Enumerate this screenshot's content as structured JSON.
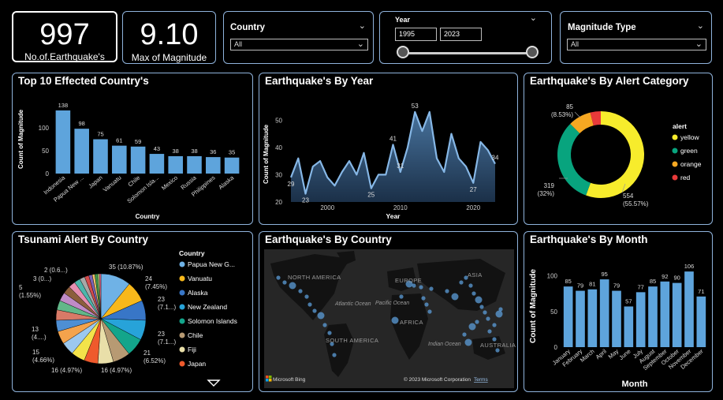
{
  "colors": {
    "bar": "#5ea4dc",
    "border": "#8fb3dc",
    "yellow": "#f7ec2c",
    "green": "#08a47e",
    "orange": "#f6a822",
    "red": "#e83a3a"
  },
  "kpi": {
    "count": {
      "value": "997",
      "label": "No.of.Earthquake's"
    },
    "max": {
      "value": "9.10",
      "label": "Max of Magnitude"
    }
  },
  "filters": {
    "country": {
      "label": "Country",
      "value": "All"
    },
    "year": {
      "label": "Year",
      "from": "1995",
      "to": "2023",
      "range": [
        1995,
        2023
      ]
    },
    "magnitude_type": {
      "label": "Magnitude Type",
      "value": "All"
    }
  },
  "panels": {
    "top10": "Top 10 Effected Country's",
    "by_year": "Earthquake's By Year",
    "alert": "Earthquake's By Alert Category",
    "tsunami": "Tsunami Alert By Country",
    "map": "Earthquake's By Country",
    "month": "Earthquake's By Month"
  },
  "map": {
    "regions": [
      {
        "name": "NORTH AMERICA",
        "style": "caps"
      },
      {
        "name": "EUROPE",
        "style": "caps"
      },
      {
        "name": "ASIA",
        "style": "caps"
      },
      {
        "name": "AFRICA",
        "style": "caps"
      },
      {
        "name": "SOUTH AMERICA",
        "style": "caps"
      },
      {
        "name": "AUSTRALIA",
        "style": "caps"
      },
      {
        "name": "Atlantic Ocean",
        "style": "ocean"
      },
      {
        "name": "Pacific Ocean",
        "style": "ocean"
      },
      {
        "name": "Indian Ocean",
        "style": "ocean"
      }
    ],
    "logo_text": "Microsoft Bing",
    "copyright": "© 2023 Microsoft Corporation",
    "terms": "Terms"
  },
  "chart_data": [
    {
      "id": "top10",
      "type": "bar",
      "categories": [
        "Indonesia",
        "Papua New ...",
        "Japan",
        "Vanuatu",
        "Chile",
        "Solomon Isla...",
        "Mexico",
        "Russia",
        "Philippines",
        "Alaska"
      ],
      "values": [
        138,
        98,
        75,
        61,
        59,
        43,
        38,
        38,
        36,
        35
      ],
      "xlabel": "Country",
      "ylabel": "Count of Magnitude",
      "ylim": [
        0,
        150
      ],
      "yticks": [
        0,
        50,
        100
      ]
    },
    {
      "id": "by_year",
      "type": "area",
      "x": [
        1995,
        1996,
        1997,
        1998,
        1999,
        2000,
        2001,
        2002,
        2003,
        2004,
        2005,
        2006,
        2007,
        2008,
        2009,
        2010,
        2011,
        2012,
        2013,
        2014,
        2015,
        2016,
        2017,
        2018,
        2019,
        2020,
        2021,
        2022,
        2023
      ],
      "values": [
        29,
        36,
        23,
        33,
        35,
        29,
        26,
        31,
        35,
        30,
        38,
        25,
        30,
        30,
        41,
        31,
        40,
        53,
        46,
        53,
        36,
        31,
        45,
        36,
        33,
        27,
        42,
        39,
        34
      ],
      "point_labels": {
        "1995": "29",
        "1997": "23",
        "2006": "25",
        "2009": "41",
        "2010": "31",
        "2012": "53",
        "2020": "27",
        "2023": "34"
      },
      "xlabel": "Year",
      "ylabel": "Count of Magnitude",
      "ylim": [
        20,
        55
      ],
      "yticks": [
        20,
        30,
        40,
        50
      ],
      "xticks": [
        2000,
        2010,
        2020
      ]
    },
    {
      "id": "alert",
      "type": "pie",
      "variant": "donut",
      "legend_title": "alert",
      "slices": [
        {
          "name": "yellow",
          "value": 554,
          "label_value": "554",
          "label_pct": "(55.57%)",
          "color": "#f7ec2c"
        },
        {
          "name": "green",
          "value": 319,
          "label_value": "319",
          "label_pct": "(32%)",
          "color": "#08a47e"
        },
        {
          "name": "orange",
          "value": 85,
          "label_value": "85",
          "label_pct": "(8.53%)",
          "color": "#f6a822"
        },
        {
          "name": "red",
          "value": 39,
          "label_value": "",
          "label_pct": "",
          "color": "#e83a3a"
        }
      ]
    },
    {
      "id": "tsunami",
      "type": "pie",
      "legend_title": "Country",
      "legend": [
        {
          "name": "Papua New G...",
          "color": "#6fb2e6"
        },
        {
          "name": "Vanuatu",
          "color": "#f8b81b"
        },
        {
          "name": "Alaska",
          "color": "#3876c7"
        },
        {
          "name": "New Zealand",
          "color": "#27a3d9"
        },
        {
          "name": "Solomon Islands",
          "color": "#13a58b"
        },
        {
          "name": "Chile",
          "color": "#b79a73"
        },
        {
          "name": "Fiji",
          "color": "#e9dfa9"
        },
        {
          "name": "Japan",
          "color": "#ef5a2c"
        }
      ],
      "slices": [
        {
          "value": 35,
          "color": "#6fb2e6"
        },
        {
          "value": 24,
          "color": "#f8b81b"
        },
        {
          "value": 23,
          "color": "#3876c7"
        },
        {
          "value": 23,
          "color": "#27a3d9"
        },
        {
          "value": 21,
          "color": "#13a58b"
        },
        {
          "value": 20,
          "color": "#b79a73"
        },
        {
          "value": 18,
          "color": "#e9dfa9"
        },
        {
          "value": 16,
          "color": "#ef5a2c"
        },
        {
          "value": 16,
          "color": "#f3e34a"
        },
        {
          "value": 15,
          "color": "#9cc8ee"
        },
        {
          "value": 15,
          "color": "#f4a34c"
        },
        {
          "value": 13,
          "color": "#4e8fd3"
        },
        {
          "value": 12,
          "color": "#d87a67"
        },
        {
          "value": 11,
          "color": "#62b789"
        },
        {
          "value": 10,
          "color": "#c08bc7"
        },
        {
          "value": 9,
          "color": "#8c5e3c"
        },
        {
          "value": 8,
          "color": "#e58fb1"
        },
        {
          "value": 7,
          "color": "#4cb6ac"
        },
        {
          "value": 6,
          "color": "#a8a8a8"
        },
        {
          "value": 5,
          "color": "#d44c4c"
        },
        {
          "value": 4,
          "color": "#7a63b5"
        },
        {
          "value": 3,
          "color": "#f0c06a"
        },
        {
          "value": 3,
          "color": "#3d9c4f"
        },
        {
          "value": 2,
          "color": "#b5d47a"
        },
        {
          "value": 2,
          "color": "#e86a8a"
        }
      ],
      "labels": [
        {
          "line1": "35 (10.87%)",
          "line2": ""
        },
        {
          "line1": "24",
          "line2": "(7.45%)"
        },
        {
          "line1": "23",
          "line2": "(7.1...)"
        },
        {
          "line1": "23",
          "line2": "(7.1...)"
        },
        {
          "line1": "21",
          "line2": "(6.52%)"
        },
        {
          "line1": "16 (4.97%)",
          "line2": ""
        },
        {
          "line1": "16 (4.97%)",
          "line2": ""
        },
        {
          "line1": "15",
          "line2": "(4.66%)"
        },
        {
          "line1": "13",
          "line2": "(4....)"
        },
        {
          "line1": "5",
          "line2": "(1.55%)"
        },
        {
          "line1": "3 (0...)",
          "line2": ""
        },
        {
          "line1": "2 (0.6...)",
          "line2": ""
        }
      ]
    },
    {
      "id": "month",
      "type": "bar",
      "categories": [
        "January",
        "February",
        "March",
        "April",
        "May",
        "June",
        "July",
        "August",
        "September",
        "October",
        "November",
        "December"
      ],
      "values": [
        85,
        79,
        81,
        95,
        79,
        57,
        77,
        85,
        92,
        90,
        106,
        71
      ],
      "xlabel": "Month",
      "ylabel": "Count of Magnitude",
      "ylim": [
        0,
        115
      ],
      "yticks": [
        0,
        50,
        100
      ]
    }
  ]
}
